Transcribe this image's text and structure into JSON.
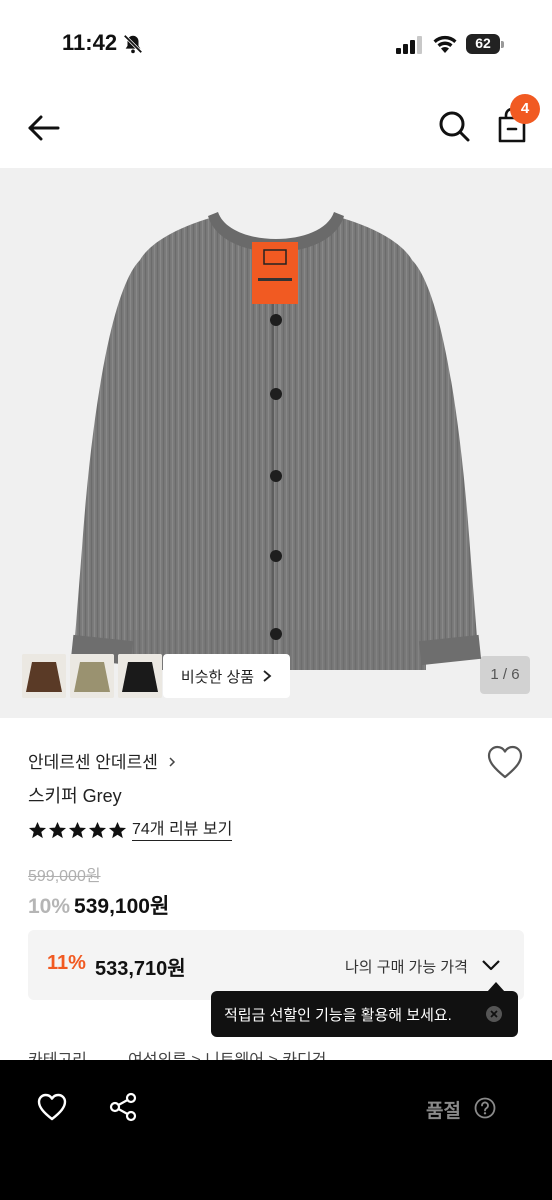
{
  "status": {
    "time": "11:42",
    "battery": "62"
  },
  "header": {
    "cart_count": "4"
  },
  "gallery": {
    "similar_label": "비슷한 상품",
    "page_indicator": "1 / 6",
    "thumbnail_colors": [
      "#5a3a26",
      "#9a9270",
      "#1a1a1a"
    ]
  },
  "product": {
    "brand": "안데르센 안데르센",
    "name": "스키퍼 Grey",
    "rating_stars": 5,
    "review_link": "74개 리뷰 보기",
    "original_price": "599,000원",
    "discount_percent": "10%",
    "sale_price": "539,100원"
  },
  "my_price": {
    "percent": "11%",
    "price": "533,710원",
    "label": "나의 구매 가능 가격"
  },
  "tooltip": {
    "text": "적립금 선할인 기능을 활용해 보세요."
  },
  "category": {
    "label": "카테고리",
    "path": "여성의류 > 니트웨어 > 카디건"
  },
  "bottom": {
    "status": "품절"
  },
  "colors": {
    "accent": "#f15a22",
    "sweater": "#7b7b7b"
  }
}
